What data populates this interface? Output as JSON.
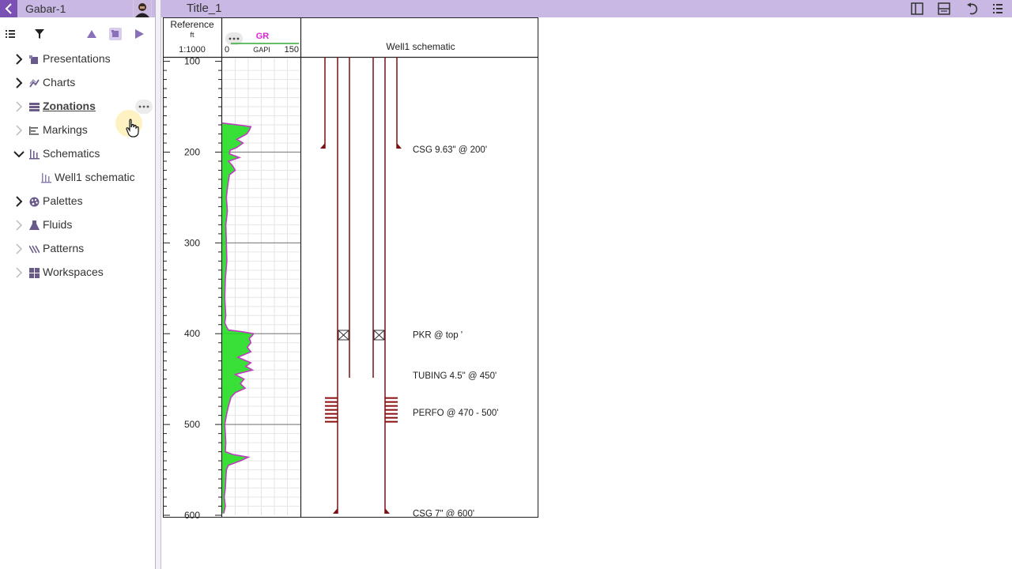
{
  "well": {
    "name": "Gabar-1"
  },
  "tree": {
    "items": [
      {
        "label": "Presentations",
        "icon": "presentation-icon",
        "expanded": false
      },
      {
        "label": "Charts",
        "icon": "chart-icon",
        "expanded": false
      },
      {
        "label": "Zonations",
        "icon": "zonation-icon",
        "expanded": false,
        "active": true
      },
      {
        "label": "Markings",
        "icon": "marking-icon",
        "expanded": false
      },
      {
        "label": "Schematics",
        "icon": "schematic-icon",
        "expanded": true,
        "children": [
          {
            "label": "Well1 schematic",
            "icon": "schematic-icon"
          }
        ]
      },
      {
        "label": "Palettes",
        "icon": "palette-icon",
        "expanded": false
      },
      {
        "label": "Fluids",
        "icon": "fluid-icon",
        "expanded": false
      },
      {
        "label": "Patterns",
        "icon": "pattern-icon",
        "expanded": false
      },
      {
        "label": "Workspaces",
        "icon": "workspace-icon",
        "expanded": false
      }
    ]
  },
  "document": {
    "title": "Title_1"
  },
  "log": {
    "reference_track": {
      "title": "Reference",
      "unit": "ft",
      "scale": "1:1000"
    },
    "gr_track": {
      "curve": "GR",
      "unit": "GAPI",
      "min": "0",
      "max": "150"
    },
    "schematic_track": {
      "title": "Well1 schematic"
    },
    "annotations": [
      {
        "text": "CSG 9.63\" @ 200'",
        "depth": 197
      },
      {
        "text": "PKR @ top '",
        "depth": 401
      },
      {
        "text": "TUBING 4.5\" @ 450'",
        "depth": 446
      },
      {
        "text": "PERFO @ 470 - 500'",
        "depth": 487
      },
      {
        "text": "CSG 7\" @ 600'",
        "depth": 598
      }
    ]
  },
  "colors": {
    "header_bar": "#c9b8e3",
    "accent": "#7b52b3",
    "gr_fill": "#22dd22",
    "gr_line": "#c03cc0",
    "gr_label": "#dd22dd",
    "casing": "#7a1010"
  },
  "chart_data": {
    "type": "area",
    "x_label": "GR",
    "x_unit": "GAPI",
    "xlim": [
      0,
      150
    ],
    "y_label": "Reference",
    "y_unit": "ft",
    "ylim": [
      96,
      600
    ],
    "ticks": [
      "100",
      "200",
      "300",
      "400",
      "500",
      "600"
    ],
    "series": [
      {
        "name": "GR",
        "depth": [
          168,
          170,
          172,
          176,
          180,
          186,
          190,
          195,
          198,
          202,
          206,
          210,
          215,
          220,
          225,
          232,
          240,
          250,
          265,
          280,
          300,
          320,
          340,
          360,
          372,
          380,
          388,
          392,
          396,
          398,
          400,
          402,
          405,
          410,
          415,
          420,
          426,
          432,
          436,
          440,
          445,
          450,
          455,
          460,
          465,
          470,
          480,
          490,
          500,
          510,
          520,
          530,
          533,
          536,
          540,
          545,
          550,
          560,
          570,
          580,
          590,
          598
        ],
        "value": [
          0,
          30,
          55,
          52,
          47,
          28,
          40,
          28,
          15,
          14,
          33,
          12,
          20,
          25,
          14,
          12,
          10,
          8,
          10,
          7,
          8,
          9,
          6,
          5,
          6,
          7,
          5,
          8,
          12,
          40,
          60,
          58,
          52,
          55,
          48,
          55,
          30,
          55,
          45,
          58,
          25,
          42,
          35,
          44,
          25,
          17,
          12,
          8,
          5,
          6,
          7,
          6,
          20,
          50,
          35,
          12,
          8,
          7,
          6,
          4,
          6,
          3
        ]
      }
    ]
  }
}
